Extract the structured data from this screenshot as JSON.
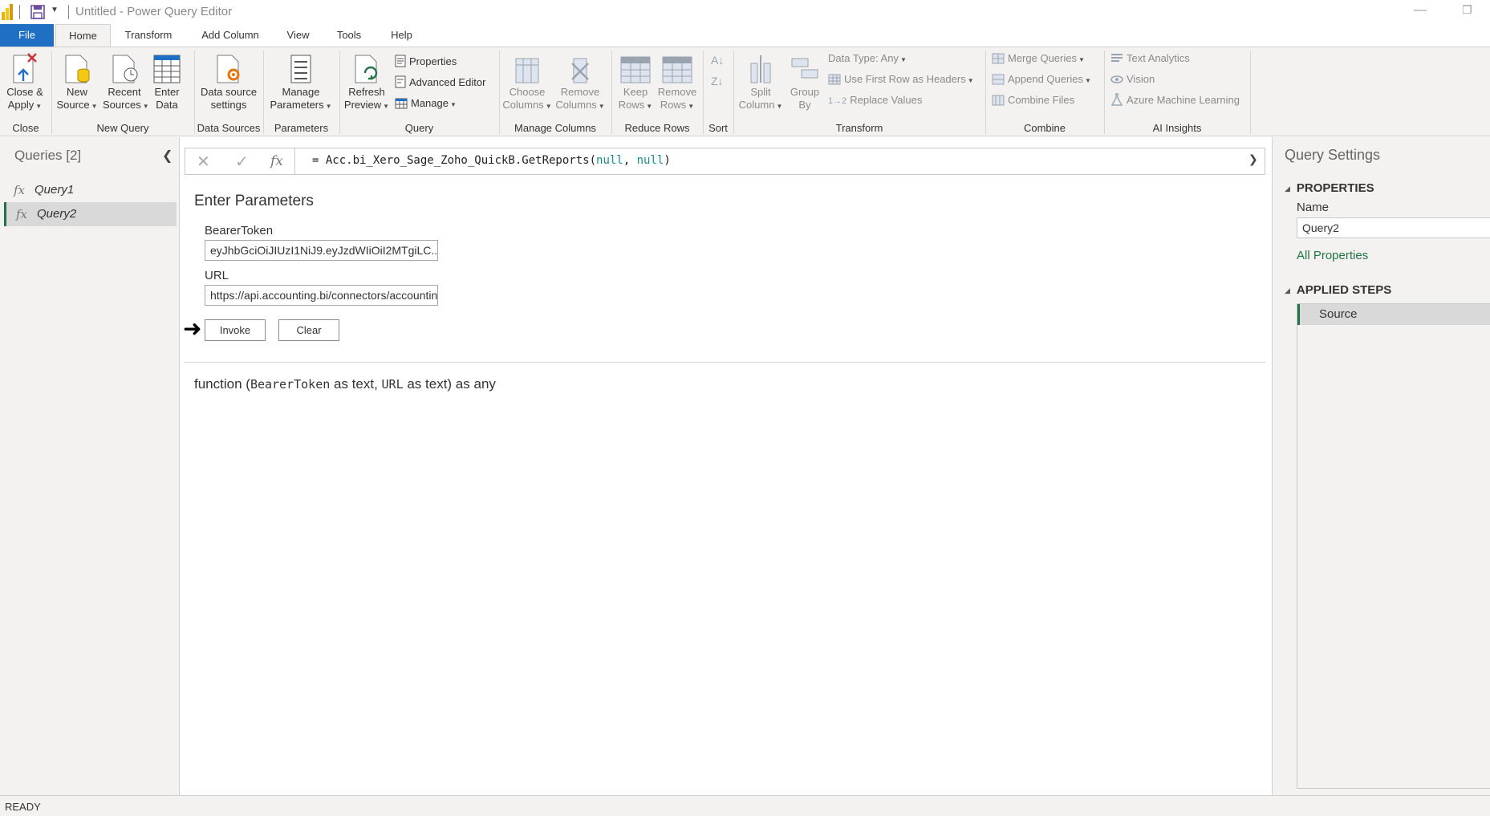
{
  "window": {
    "title": "Untitled - Power Query Editor"
  },
  "tabs": [
    {
      "label": "File"
    },
    {
      "label": "Home"
    },
    {
      "label": "Transform"
    },
    {
      "label": "Add Column"
    },
    {
      "label": "View"
    },
    {
      "label": "Tools"
    },
    {
      "label": "Help"
    }
  ],
  "ribbon": {
    "close_apply": [
      "Close &",
      "Apply"
    ],
    "new_source": [
      "New",
      "Source"
    ],
    "recent_sources": [
      "Recent",
      "Sources"
    ],
    "enter_data": [
      "Enter",
      "Data"
    ],
    "data_source_settings": [
      "Data source",
      "settings"
    ],
    "manage_parameters": [
      "Manage",
      "Parameters"
    ],
    "refresh_preview": [
      "Refresh",
      "Preview"
    ],
    "properties": "Properties",
    "advanced_editor": "Advanced Editor",
    "manage": "Manage",
    "choose_columns": [
      "Choose",
      "Columns"
    ],
    "remove_columns": [
      "Remove",
      "Columns"
    ],
    "keep_rows": [
      "Keep",
      "Rows"
    ],
    "remove_rows": [
      "Remove",
      "Rows"
    ],
    "split_column": [
      "Split",
      "Column"
    ],
    "group_by": [
      "Group",
      "By"
    ],
    "data_type": "Data Type: Any",
    "use_first_row": "Use First Row as Headers",
    "replace_values": "Replace Values",
    "merge_queries": "Merge Queries",
    "append_queries": "Append Queries",
    "combine_files": "Combine Files",
    "text_analytics": "Text Analytics",
    "vision": "Vision",
    "azure_ml": "Azure Machine Learning",
    "groups": {
      "close": "Close",
      "new_query": "New Query",
      "data_sources": "Data Sources",
      "parameters": "Parameters",
      "query": "Query",
      "manage_columns": "Manage Columns",
      "reduce_rows": "Reduce Rows",
      "sort": "Sort",
      "transform": "Transform",
      "combine": "Combine",
      "ai_insights": "AI Insights"
    }
  },
  "queries": {
    "header": "Queries [2]",
    "items": [
      {
        "name": "Query1"
      },
      {
        "name": "Query2"
      }
    ]
  },
  "formula": {
    "prefix": "= Acc.bi_Xero_Sage_Zoho_QuickB.GetReports(",
    "arg1": "null",
    "comma": ", ",
    "arg2": "null",
    "suffix": ")"
  },
  "params": {
    "title": "Enter Parameters",
    "bearer_label": "BearerToken",
    "bearer_value": "eyJhbGciOiJIUzI1NiJ9.eyJzdWIiOiI2MTgiLC...",
    "url_label": "URL",
    "url_value": "https://api.accounting.bi/connectors/accounting",
    "invoke": "Invoke",
    "clear": "Clear"
  },
  "signature": {
    "part1": "function (",
    "p1": "BearerToken",
    "part2": " as text, ",
    "p2": "URL",
    "part3": " as text) as any"
  },
  "settings": {
    "header": "Query Settings",
    "properties": "PROPERTIES",
    "name_label": "Name",
    "name_value": "Query2",
    "all_properties": "All Properties",
    "applied_steps": "APPLIED STEPS",
    "steps": [
      {
        "name": "Source"
      }
    ]
  },
  "status": "READY",
  "colors": {
    "accent": "#217346",
    "file_tab": "#1f6fc5"
  }
}
